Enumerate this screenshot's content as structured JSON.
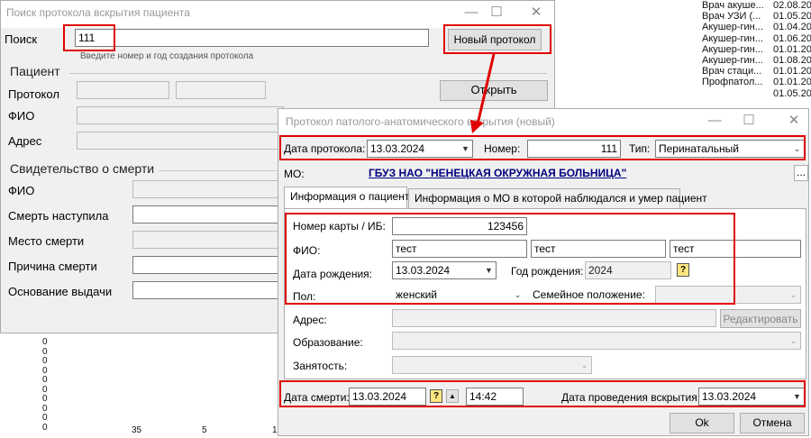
{
  "background_list": {
    "rows": [
      {
        "role": "Врач акуше...",
        "date": "02.08.20"
      },
      {
        "role": "Врач УЗИ (...",
        "date": "01.05.20"
      },
      {
        "role": "Акушер-гин...",
        "date": "01.04.20"
      },
      {
        "role": "Акушер-гин...",
        "date": "01.06.20"
      },
      {
        "role": "Акушер-гин...",
        "date": "01.01.20"
      },
      {
        "role": "Акушер-гин...",
        "date": "01.08.20"
      },
      {
        "role": "Врач стаци...",
        "date": "01.01.20"
      },
      {
        "role": "Профпатол...",
        "date": "01.01.20"
      },
      {
        "role": "",
        "date": "01.05.20"
      }
    ],
    "zero_column": [
      "0",
      "0",
      "0",
      "0",
      "0",
      "0",
      "0",
      "0",
      "0",
      "0"
    ],
    "bottom_numbers": [
      "35",
      "5",
      "1"
    ]
  },
  "search_window": {
    "title": "Поиск протокола вскрытия пациента",
    "search_label": "Поиск",
    "search_value": "111",
    "search_hint": "Введите номер и год создания протокола",
    "new_protocol_button": "Новый протокол",
    "patient_group": "Пациент",
    "protocol_label": "Протокол",
    "fio_label": "ФИО",
    "address_label": "Адрес",
    "open_button": "Открыть",
    "death_cert_group": "Свидетельство о смерти",
    "cert_fio_label": "ФИО",
    "death_occurred_label": "Смерть наступила",
    "death_place_label": "Место смерти",
    "death_cause_label": "Причина смерти",
    "issue_basis_label": "Основание выдачи"
  },
  "protocol_window": {
    "title": "Протокол патолого-анатомического вскрытия (новый)",
    "protocol_date_label": "Дата протокола:",
    "protocol_date_value": "13.03.2024",
    "number_label": "Номер:",
    "number_value": "111",
    "type_label": "Тип:",
    "type_value": "Перинатальный",
    "mo_label": "МО:",
    "mo_value": "ГБУЗ НАО \"НЕНЕЦКАЯ ОКРУЖНАЯ БОЛЬНИЦА\"",
    "mo_button": "...",
    "tabs": [
      {
        "label": "Информация о пациенте",
        "active": true
      },
      {
        "label": "Информация о МО в которой наблюдался и умер пациент",
        "active": false
      }
    ],
    "card_label": "Номер карты / ИБ:",
    "card_value": "123456",
    "fio_label": "ФИО:",
    "fio_values": [
      "тест",
      "тест",
      "тест"
    ],
    "birth_date_label": "Дата рождения:",
    "birth_date_value": "13.03.2024",
    "birth_year_label": "Год рождения:",
    "birth_year_value": "2024",
    "help_glyph": "?",
    "sex_label": "Пол:",
    "sex_value": "женский",
    "marital_label": "Семейное положение:",
    "address_label": "Адрес:",
    "edit_button": "Редактировать",
    "education_label": "Образование:",
    "employment_label": "Занятость:",
    "death_date_label": "Дата смерти:",
    "death_date_value": "13.03.2024",
    "death_time_value": "14:42",
    "autopsy_date_label": "Дата проведения вскрытия:",
    "autopsy_date_value": "13.03.2024",
    "ok_button": "Ok",
    "cancel_button": "Отмена"
  },
  "colors": {
    "highlight": "#e00000",
    "mo_link": "#000080",
    "window_bg": "#f0f0f0"
  }
}
